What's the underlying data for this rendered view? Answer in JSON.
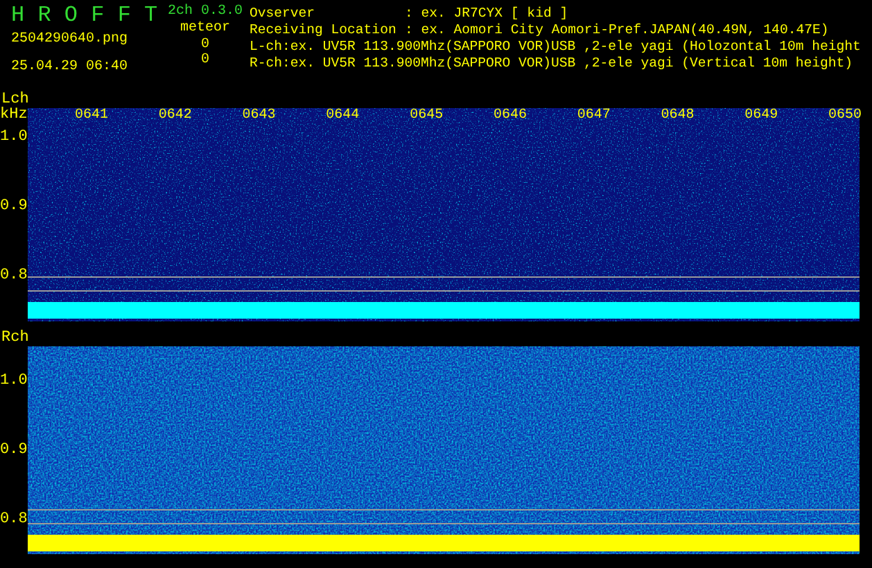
{
  "header": {
    "title": "H R O F F T",
    "version": "2ch 0.3.0",
    "filename": "2504290640.png",
    "timestamp": "25.04.29 06:40",
    "meteor_label": "meteor",
    "meteor_counts": [
      "0",
      "0"
    ]
  },
  "info": [
    {
      "kind": "field",
      "label": "Ovserver",
      "value": ": ex. JR7CYX [ kid ]"
    },
    {
      "kind": "field",
      "label": "Receiving Location",
      "value": ": ex. Aomori City Aomori-Pref.JAPAN(40.49N, 140.47E)"
    },
    {
      "kind": "line",
      "text": "L-ch:ex. UV5R 113.900Mhz(SAPPORO VOR)USB ,2-ele yagi (Holozontal 10m height"
    },
    {
      "kind": "line",
      "text": "R-ch:ex. UV5R 113.900Mhz(SAPPORO VOR)USB ,2-ele yagi (Vertical 10m height)"
    }
  ],
  "channels": [
    {
      "label": "Lch",
      "unit": "kHz",
      "kind": "quiet",
      "color": "#00ffff",
      "times": [
        "0641",
        "0642",
        "0643",
        "0644",
        "0645",
        "0646",
        "0647",
        "0648",
        "0649",
        "0650"
      ],
      "yticks": [
        "1.0",
        "0.9",
        "0.8"
      ]
    },
    {
      "label": "Rch",
      "kind": "noisy",
      "color": "#ffff00",
      "yticks": [
        "1.0",
        "0.9",
        "0.8"
      ]
    }
  ]
}
